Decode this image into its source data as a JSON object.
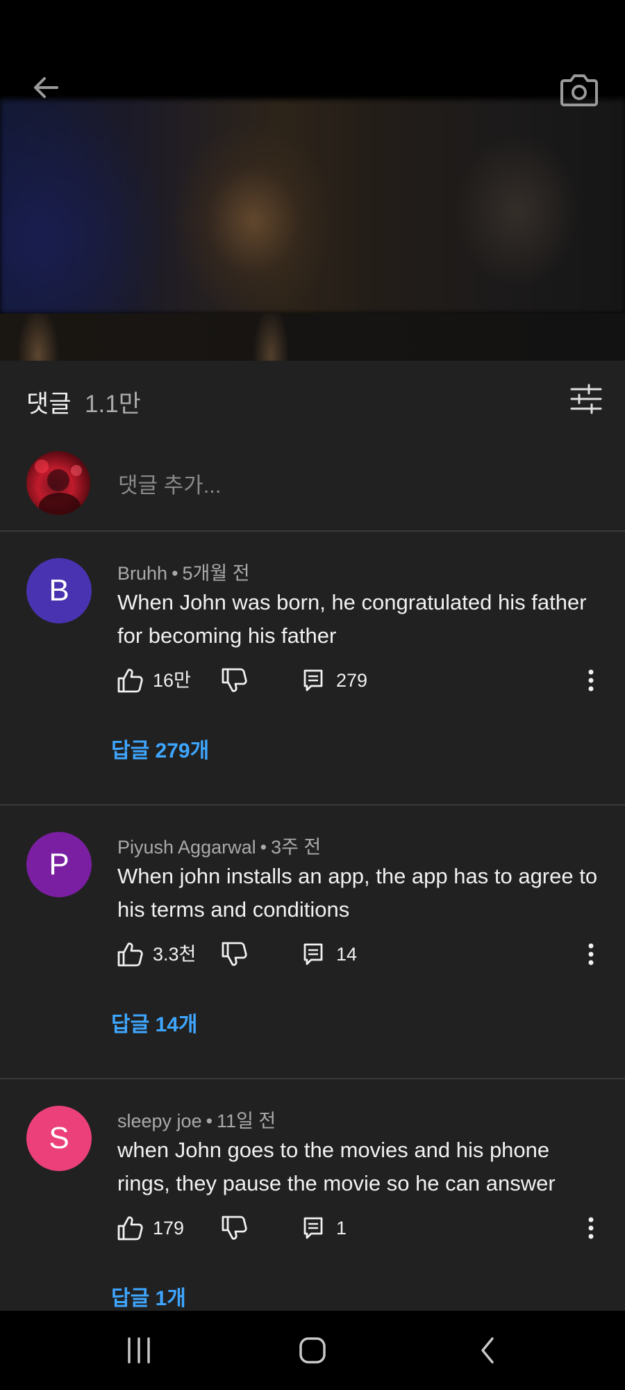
{
  "header": {
    "back_icon": "arrow-left-icon",
    "camera_icon": "camera-icon"
  },
  "comments_section": {
    "title": "댓글",
    "count": "1.1만",
    "filter_icon": "sliders-icon",
    "add_comment_placeholder": "댓글 추가..."
  },
  "comments": [
    {
      "avatar_letter": "B",
      "avatar_color": "#4a33b0",
      "author": "Bruhh",
      "time": "5개월 전",
      "text": "When John was born, he congratulated his father for becoming his father",
      "likes": "16만",
      "replies_count": "279",
      "replies_link": "답글 279개"
    },
    {
      "avatar_letter": "P",
      "avatar_color": "#7b1fa2",
      "author": "Piyush Aggarwal",
      "time": "3주 전",
      "text": "When john installs an app, the app has to agree to his terms and conditions",
      "likes": "3.3천",
      "replies_count": "14",
      "replies_link": "답글 14개"
    },
    {
      "avatar_letter": "S",
      "avatar_color": "#ec407a",
      "author": "sleepy joe",
      "time": "11일 전",
      "text": "when John goes to the movies and his phone rings, they pause the movie so he can answer",
      "likes": "179",
      "replies_count": "1",
      "replies_link": "답글 1개"
    }
  ],
  "colors": {
    "background": "#212121",
    "link": "#3ea6ff",
    "secondary_text": "#aaaaaa"
  }
}
